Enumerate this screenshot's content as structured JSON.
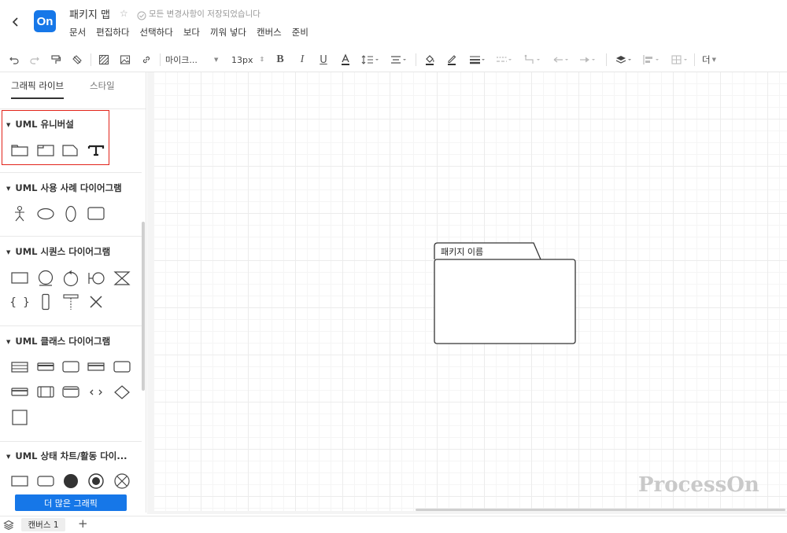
{
  "header": {
    "logo_text": "On",
    "title": "패키지 맵",
    "save_status": "모든 변경사항이 저장되었습니다",
    "menu": [
      "문서",
      "편집하다",
      "선택하다",
      "보다",
      "끼워 넣다",
      "캔버스",
      "준비"
    ]
  },
  "toolbar": {
    "font_family": "마이크...",
    "font_size": "13px",
    "more_label": "더"
  },
  "sidebar": {
    "tabs": [
      "그래픽 라이브",
      "스타일"
    ],
    "sections": [
      {
        "title": "UML 유니버설"
      },
      {
        "title": "UML 사용 사례 다이어그램"
      },
      {
        "title": "UML 시퀀스 다이어그램"
      },
      {
        "title": "UML 클래스 다이어그램"
      },
      {
        "title": "UML 상태 차트/활동 다이..."
      }
    ],
    "more_button": "더 많은 그래픽"
  },
  "canvas": {
    "package_label": "패키지 이름",
    "watermark": "ProcessOn"
  },
  "bottombar": {
    "page_tab": "캔버스 1",
    "add_label": "+"
  },
  "colors": {
    "accent": "#1677e8",
    "highlight": "#e2231a"
  }
}
